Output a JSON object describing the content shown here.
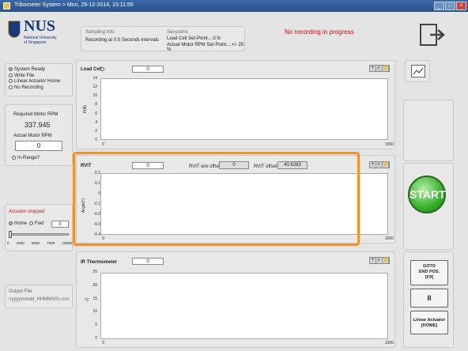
{
  "window": {
    "title": "Tribometer System > Mon, 29-12-2014, 15:11:55"
  },
  "logo": {
    "name": "NUS",
    "sub1": "National University",
    "sub2": "of Singapore"
  },
  "sampling": {
    "title": "Sampling Info",
    "text": "Recording at 0.5 Seconds intervals"
  },
  "setpoints": {
    "title": "Set-points",
    "line1": "Load Cell Set-Point....0 N",
    "line2": "Actual Motor RPM Set-Point....+/- 25 %"
  },
  "status_banner": "No recording in progress",
  "status_list": [
    "System Ready",
    "Write File",
    "Linear Actuator Home",
    "No Recording"
  ],
  "motor": {
    "required_label": "Required Motor RPM",
    "required_value": "337.945",
    "actual_label": "Actual Motor RPM",
    "actual_value": "0",
    "in_range": "In-Range?"
  },
  "actuator": {
    "status": "Actuator stopped",
    "home": "Home",
    "fwd": "Fwd",
    "value": "0",
    "scale": [
      "0",
      "2500",
      "5000",
      "7500",
      "10000"
    ]
  },
  "output_file": {
    "label": "Output File",
    "value": "<yyyymmdd_HHMMSS>.csv"
  },
  "loadcell": {
    "label": "Load Cell",
    "value": "0",
    "ylabel": "F(N)",
    "yticks": [
      "14",
      "12",
      "10",
      "8",
      "6",
      "4",
      "2",
      "0"
    ],
    "xticks": [
      "0",
      "1000"
    ]
  },
  "rvit": {
    "label": "RVIT",
    "value": "0",
    "offset_wo_label": "RVIT w/o offset",
    "offset_wo_value": "0",
    "offset_label": "RVIT offset",
    "offset_value": "40.6283",
    "ylabel": "Angle(°)",
    "yticks": [
      "0.2",
      "0.1",
      "0",
      "-0.1",
      "-0.2",
      "-0.3",
      "-0.4"
    ],
    "xticks": [
      "0",
      "1000"
    ]
  },
  "ir": {
    "label": "IR Thermometer",
    "value": "0",
    "ylabel": "°C",
    "yticks": [
      "25",
      "20",
      "15",
      "10",
      "5",
      "0"
    ],
    "xticks": [
      "0",
      "1000"
    ]
  },
  "buttons": {
    "start": "START",
    "goto_line1": "GOTO",
    "goto_line2": "END POS.",
    "goto_line3": "[F9]",
    "pause": "II",
    "home_line1": "Linear Actuator",
    "home_line2": "[HOME]"
  },
  "highlight_color": "#f0922b"
}
